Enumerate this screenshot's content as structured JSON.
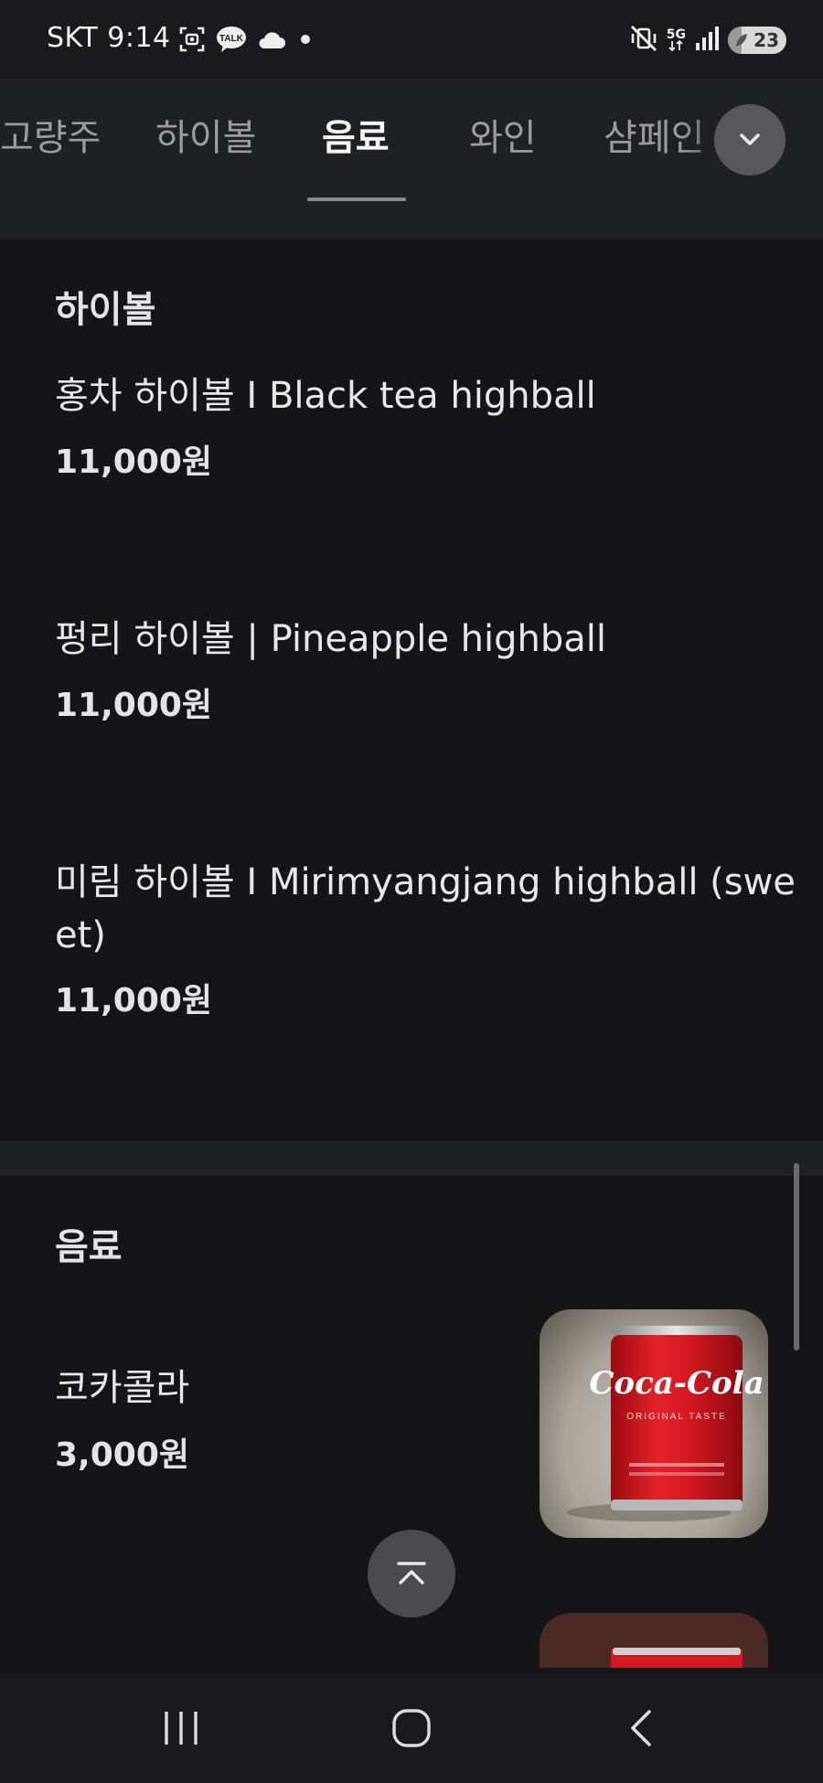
{
  "status_bar": {
    "carrier_time": "SKT 9:14",
    "network": "5G",
    "battery_level": "23",
    "icons": [
      "screenshot-icon",
      "kakaotalk-icon",
      "cloud-icon",
      "notification-dot-icon",
      "mute-vibrate-icon",
      "5g-icon",
      "signal-icon",
      "battery-icon"
    ],
    "talk_label": "TALK"
  },
  "categories": {
    "tabs": [
      {
        "label": "고량주"
      },
      {
        "label": "하이볼"
      },
      {
        "label": "음료"
      },
      {
        "label": "와인"
      },
      {
        "label": "샴페인"
      }
    ],
    "active_tab": "음료"
  },
  "sections": {
    "highball": {
      "title": "하이볼",
      "items": [
        {
          "name": "홍차 하이볼 I Black tea highball",
          "price": "11,000원"
        },
        {
          "name": "펑리 하이볼 | Pineapple highball",
          "price": "11,000원"
        },
        {
          "name_line1": "미림 하이볼 I Mirimyangjang highball (swe",
          "name_line2": "et)",
          "price": "11,000원"
        }
      ]
    },
    "drinks": {
      "title": "음료",
      "items": [
        {
          "name": "코카콜라",
          "price": "3,000원"
        }
      ]
    }
  },
  "product_image": {
    "brand_text": "Coca-Cola",
    "sub_text": "ORIGINAL TASTE"
  },
  "colors": {
    "background": "#151517",
    "coke_red": "#d4141c"
  }
}
